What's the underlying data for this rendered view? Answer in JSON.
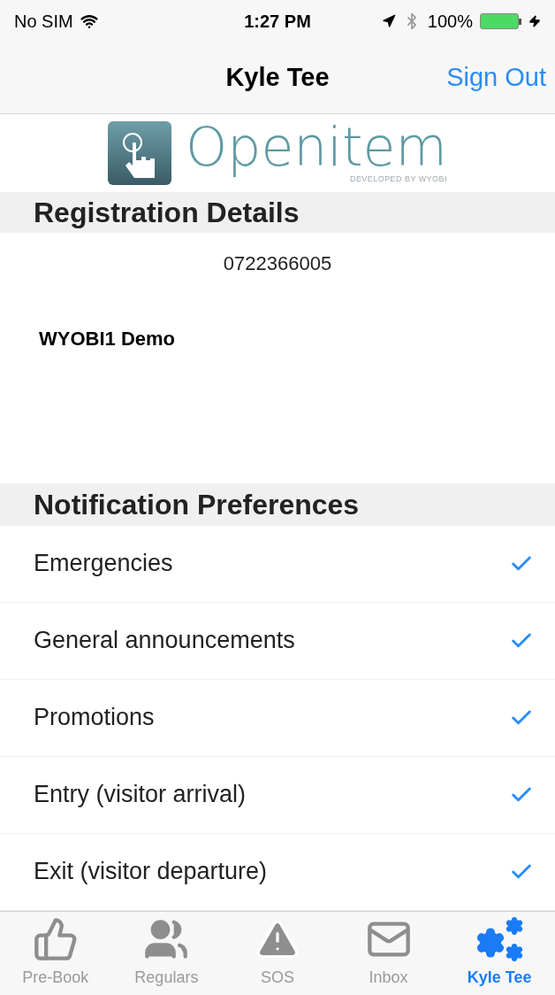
{
  "status_bar": {
    "carrier": "No SIM",
    "time": "1:27 PM",
    "battery": "100%"
  },
  "nav_bar": {
    "title": "Kyle Tee",
    "action": "Sign Out"
  },
  "logo": {
    "name": "Openitem",
    "tagline": "DEVELOPED BY WYOBI"
  },
  "registration": {
    "heading": "Registration Details",
    "phone": "0722366005",
    "company": "WYOBI1 Demo"
  },
  "notifications": {
    "heading": "Notification Preferences",
    "items": [
      {
        "label": "Emergencies",
        "checked": true
      },
      {
        "label": "General announcements",
        "checked": true
      },
      {
        "label": "Promotions",
        "checked": true
      },
      {
        "label": "Entry (visitor arrival)",
        "checked": true
      },
      {
        "label": "Exit (visitor departure)",
        "checked": true
      }
    ]
  },
  "tab_bar": [
    {
      "kind": "thumb",
      "label": "Pre-Book",
      "selected": false
    },
    {
      "kind": "people",
      "label": "Regulars",
      "selected": false
    },
    {
      "kind": "alert",
      "label": "SOS",
      "selected": false
    },
    {
      "kind": "mail",
      "label": "Inbox",
      "selected": false
    },
    {
      "kind": "gears",
      "label": "Kyle Tee",
      "selected": true
    }
  ]
}
